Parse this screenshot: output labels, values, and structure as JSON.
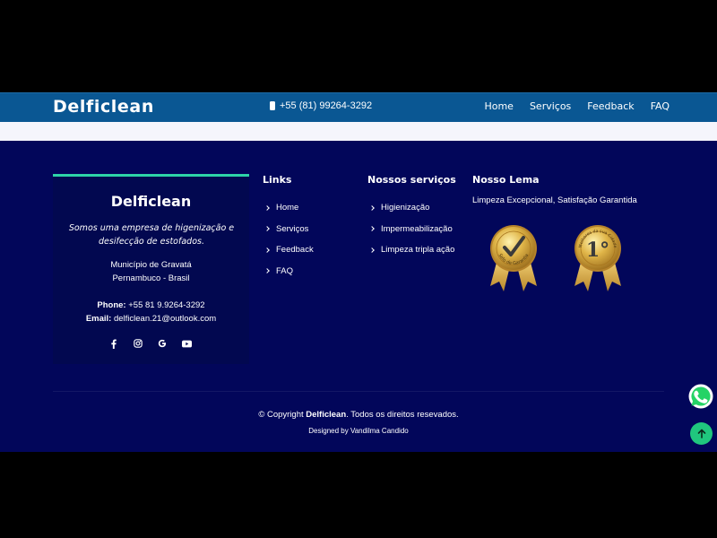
{
  "header": {
    "brand": "Delficlean",
    "phone": "+55 (81) 99264-3292",
    "nav": [
      "Home",
      "Serviços",
      "Feedback",
      "FAQ"
    ]
  },
  "about": {
    "title": "Delficlean",
    "description": "Somos uma empresa de higenização e desifecção de estofados.",
    "address_line1": "Município de Gravatá",
    "address_line2": "Pernambuco - Brasil",
    "phone_label": "Phone:",
    "phone_value": "+55 81 9.9264-3292",
    "email_label": "Email:",
    "email_value": "delficlean.21@outlook.com",
    "socials": [
      "facebook-icon",
      "instagram-icon",
      "google-icon",
      "youtube-icon"
    ]
  },
  "links": {
    "title": "Links",
    "items": [
      "Home",
      "Serviços",
      "Feedback",
      "FAQ"
    ]
  },
  "services": {
    "title": "Nossos serviços",
    "items": [
      "Higienização",
      "Impermeabilização",
      "Limpeza tripla ação"
    ]
  },
  "motto": {
    "title": "Nosso Lema",
    "text": "Limpeza Excepcional, Satisfação Garantida",
    "badge1_text": "Selo de Garantia",
    "badge2_text": "Melhores da sua Cidade",
    "badge2_number": "1°"
  },
  "footer": {
    "copyright_prefix": "© Copyright ",
    "copyright_brand": "Delficlean",
    "copyright_suffix": ". Todos os direitos resevados.",
    "credit": "Designed by Vandilma Candido"
  },
  "colors": {
    "nav_bg": "#0a5793",
    "page_bg": "#02065a",
    "accent": "#2dd3a8",
    "whatsapp": "#25d366",
    "to_top": "#20c77e"
  }
}
